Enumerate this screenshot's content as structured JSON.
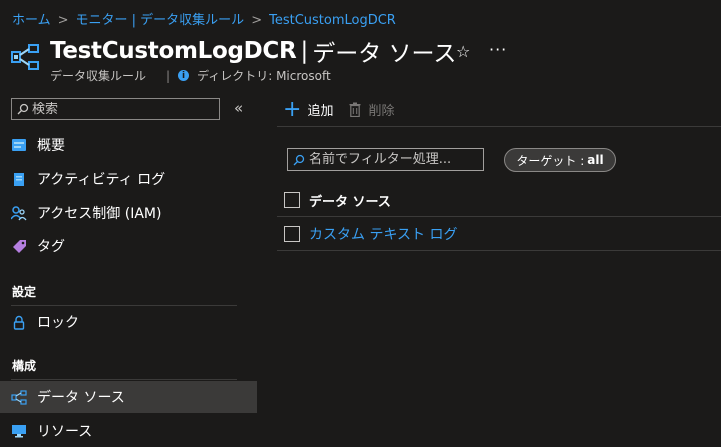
{
  "breadcrumb": [
    "ホーム",
    "モニター | データ収集ルール",
    "TestCustomLogDCR"
  ],
  "header": {
    "title": "TestCustomLogDCR",
    "separator": "|",
    "section": "データ ソース",
    "subtitle_type": "データ収集ルール",
    "subtitle_directory": "ディレクトリ: Microsoft",
    "star_icon": "☆",
    "more_icon": "···"
  },
  "sidebar": {
    "search_placeholder": "検索",
    "collapse_icon": "«",
    "items_top": [
      {
        "label": "概要",
        "icon": "overview-icon"
      },
      {
        "label": "アクティビティ ログ",
        "icon": "activity-log-icon"
      },
      {
        "label": "アクセス制御 (IAM)",
        "icon": "access-control-icon"
      },
      {
        "label": "タグ",
        "icon": "tag-icon"
      }
    ],
    "section_settings": "設定",
    "items_settings": [
      {
        "label": "ロック",
        "icon": "lock-icon"
      }
    ],
    "section_config": "構成",
    "items_config": [
      {
        "label": "データ ソース",
        "icon": "data-source-icon",
        "active": true
      },
      {
        "label": "リソース",
        "icon": "resource-icon"
      }
    ]
  },
  "toolbar": {
    "add_label": "追加",
    "delete_label": "削除"
  },
  "filter": {
    "placeholder": "名前でフィルター処理...",
    "pill_label": "ターゲット :",
    "pill_value": "all"
  },
  "table": {
    "header": "データ ソース",
    "rows": [
      "カスタム テキスト ログ"
    ]
  },
  "colors": {
    "background": "#1b1a19",
    "link": "#3aa0f3",
    "active_item": "#3b3a39"
  }
}
